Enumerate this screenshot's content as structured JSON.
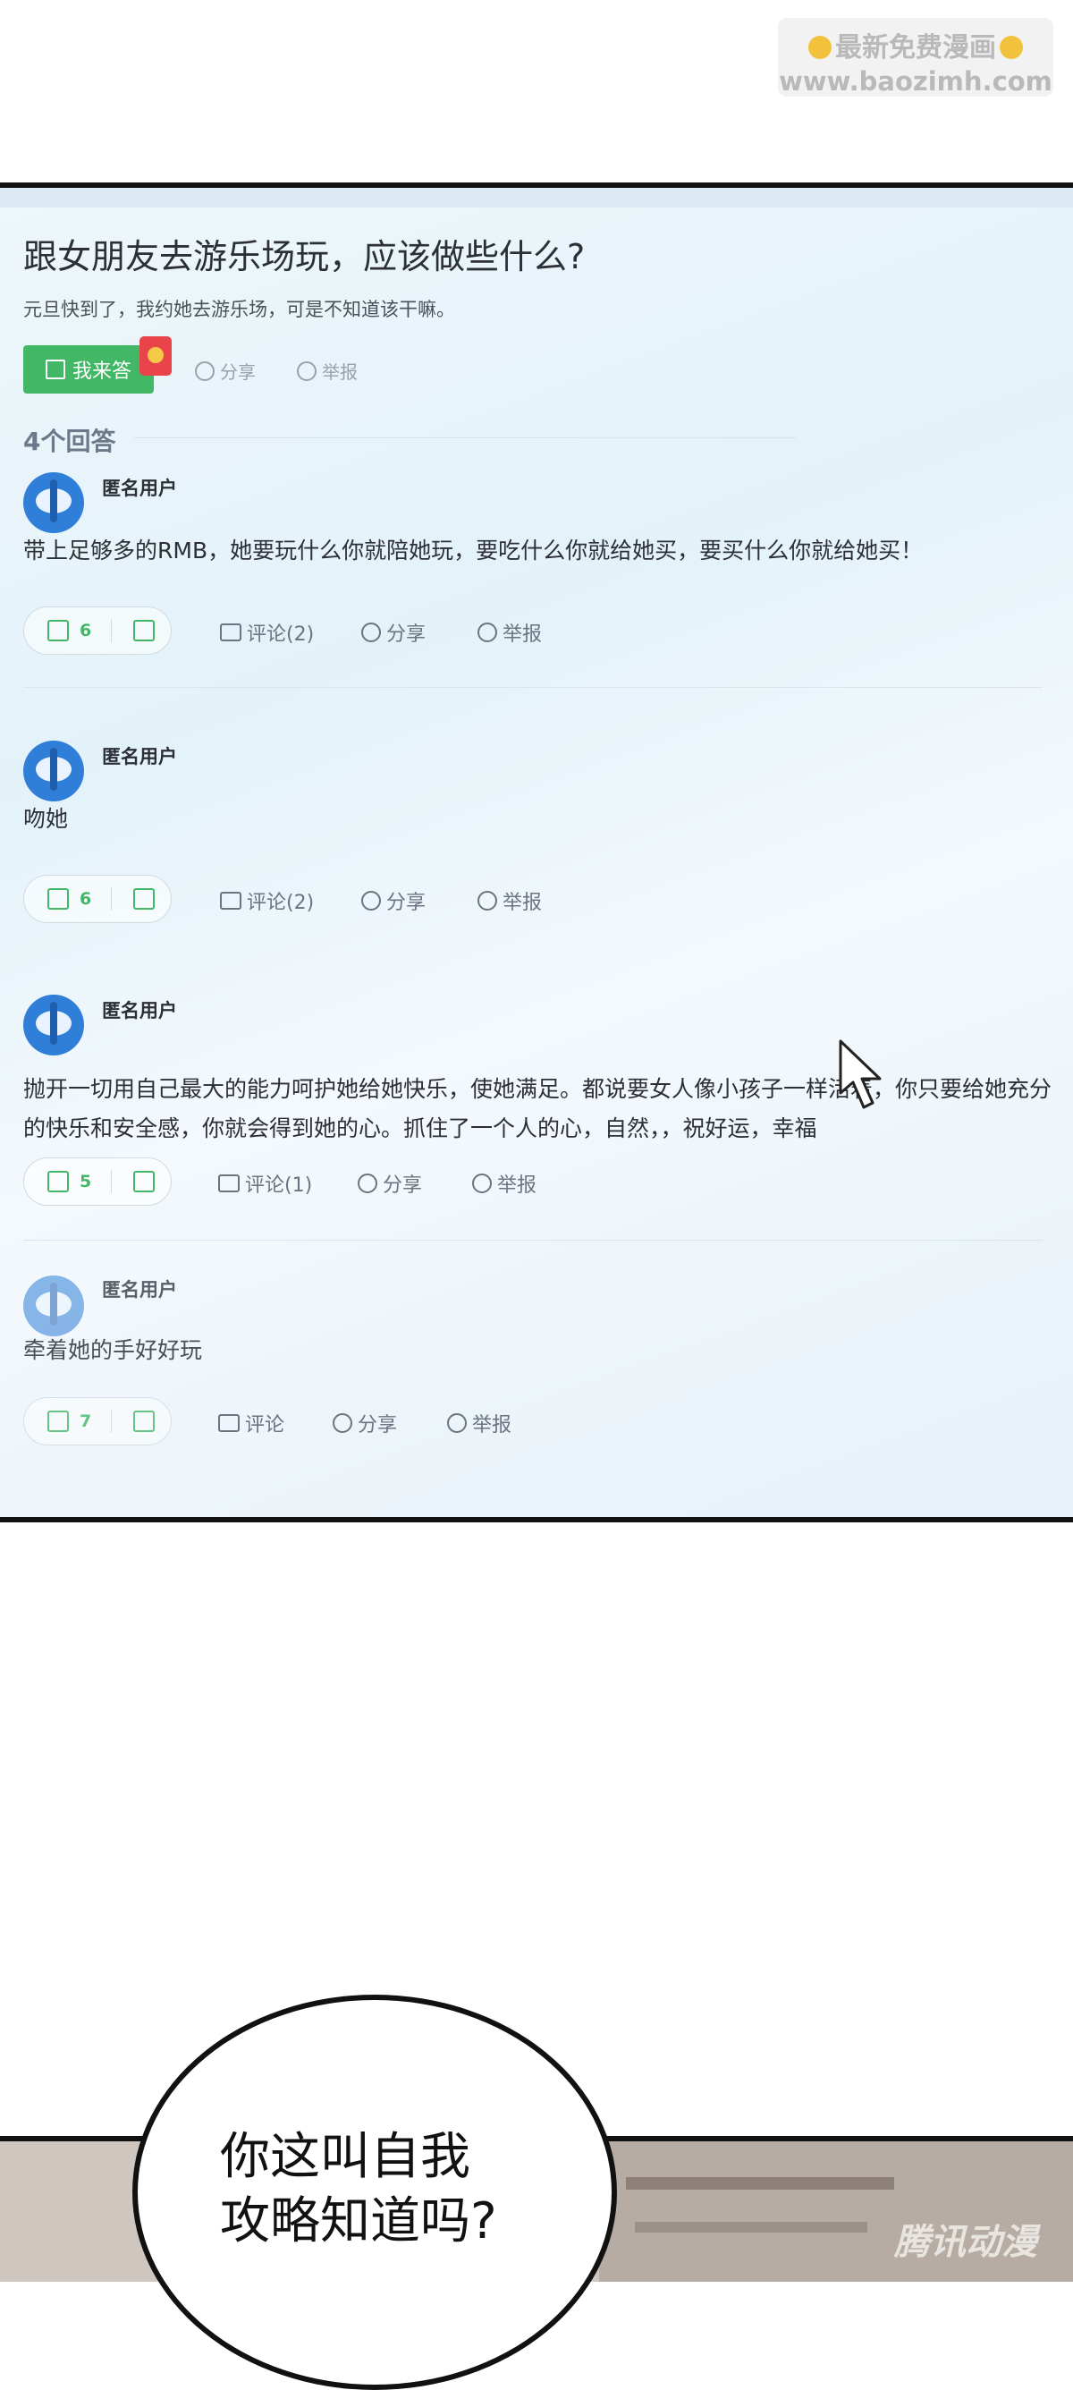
{
  "watermark": {
    "line1": "最新免费漫画",
    "line2": "www.baozimh.com"
  },
  "question": {
    "title": "跟女朋友去游乐场玩，应该做些什么?",
    "description": "元旦快到了，我约她去游乐场，可是不知道该干嘛。",
    "answer_button": "我来答",
    "share": "分享",
    "report": "举报"
  },
  "answers_count": "4个回答",
  "answers": [
    {
      "user": "匿名用户",
      "text": "带上足够多的RMB，她要玩什么你就陪她玩，要吃什么你就给她买，要买什么你就给她买！",
      "likes": "6",
      "comment": "评论(2)",
      "share": "分享",
      "report": "举报"
    },
    {
      "user": "匿名用户",
      "text": "吻她",
      "likes": "6",
      "comment": "评论(2)",
      "share": "分享",
      "report": "举报"
    },
    {
      "user": "匿名用户",
      "text": "抛开一切用自己最大的能力呵护她给她快乐，使她满足。都说要女人像小孩子一样活着，你只要给她充分的快乐和安全感，你就会得到她的心。抓住了一个人的心，自然，，祝好运，幸福",
      "likes": "5",
      "comment": "评论(1)",
      "share": "分享",
      "report": "举报"
    },
    {
      "user": "匿名用户",
      "text": "牵着她的手好好玩",
      "likes": "7",
      "comment": "评论",
      "share": "分享",
      "report": "举报"
    }
  ],
  "speech_bubble": {
    "line1": "你这叫自我",
    "line2": "攻略知道吗?"
  },
  "scene_watermark": "腾讯动漫",
  "colors": {
    "accent_green": "#42b867",
    "red_packet": "#e8444a"
  }
}
